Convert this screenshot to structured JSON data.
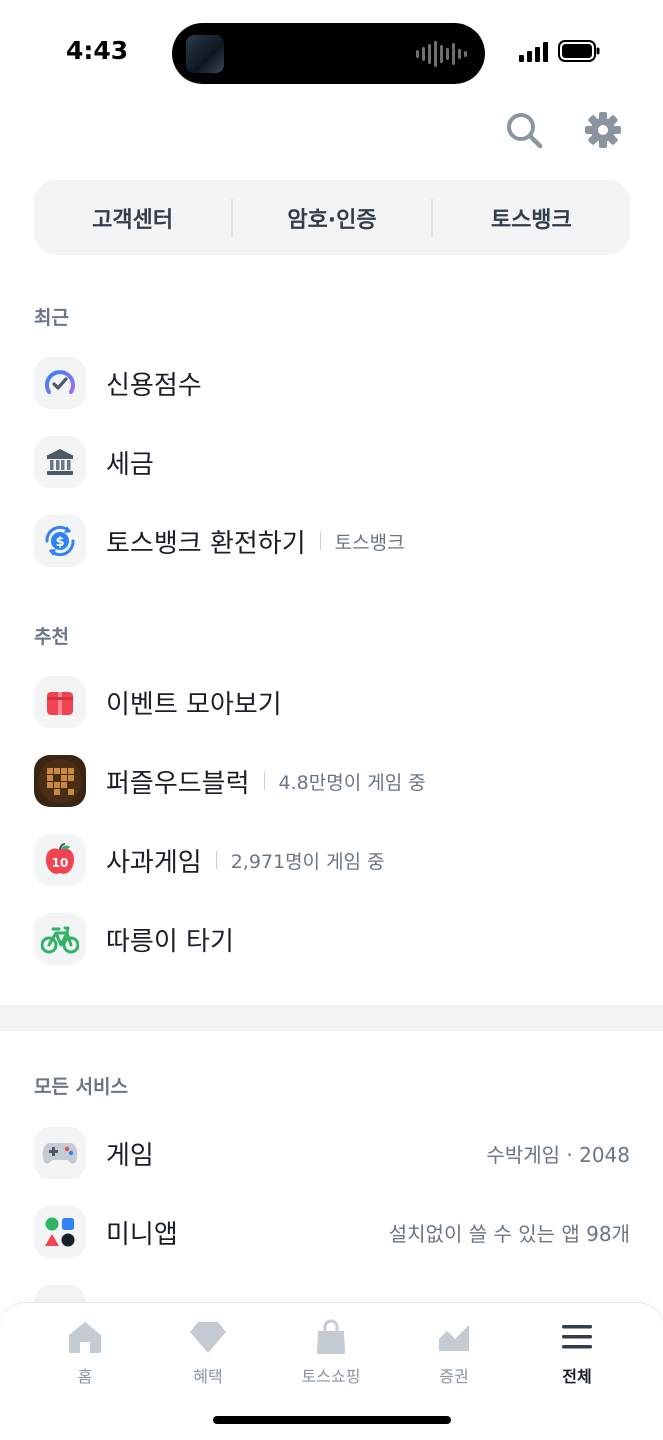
{
  "status_bar": {
    "time": "4:43"
  },
  "top_actions": {
    "search_icon": "search-icon",
    "settings_icon": "gear-icon"
  },
  "quick_menu": [
    "고객센터",
    "암호·인증",
    "토스뱅크"
  ],
  "recent": {
    "label": "최근",
    "items": [
      {
        "label": "신용점수",
        "icon": "credit-score-gauge-icon"
      },
      {
        "label": "세금",
        "icon": "bank-building-icon"
      },
      {
        "label": "토스뱅크 환전하기",
        "sub": "토스뱅크",
        "icon": "currency-exchange-icon"
      }
    ]
  },
  "recommended": {
    "label": "추천",
    "items": [
      {
        "label": "이벤트 모아보기",
        "icon": "gift-box-icon"
      },
      {
        "label": "퍼즐우드블럭",
        "sub": "4.8만명이 게임 중",
        "icon": "wood-block-puzzle-icon"
      },
      {
        "label": "사과게임",
        "sub": "2,971명이 게임 중",
        "icon": "apple-ten-icon"
      },
      {
        "label": "따릉이 타기",
        "icon": "bicycle-icon"
      }
    ]
  },
  "all_services": {
    "label": "모든 서비스",
    "items": [
      {
        "label": "게임",
        "right": "수박게임 · 2048",
        "icon": "gamepad-icon"
      },
      {
        "label": "미니앱",
        "right": "설치없이 쓸 수 있는 앱 98개",
        "icon": "shapes-icon"
      }
    ]
  },
  "bottom_nav": {
    "items": [
      {
        "label": "홈",
        "icon": "home-icon"
      },
      {
        "label": "혜택",
        "icon": "diamond-icon"
      },
      {
        "label": "토스쇼핑",
        "icon": "shopping-bag-icon"
      },
      {
        "label": "증권",
        "icon": "stock-chart-icon"
      },
      {
        "label": "전체",
        "icon": "menu-icon"
      }
    ],
    "active": "전체"
  },
  "colors": {
    "accent_blue": "#3182f6",
    "text": "#191f28",
    "sub_text": "#6b7684",
    "bg_gray": "#f2f4f6"
  }
}
